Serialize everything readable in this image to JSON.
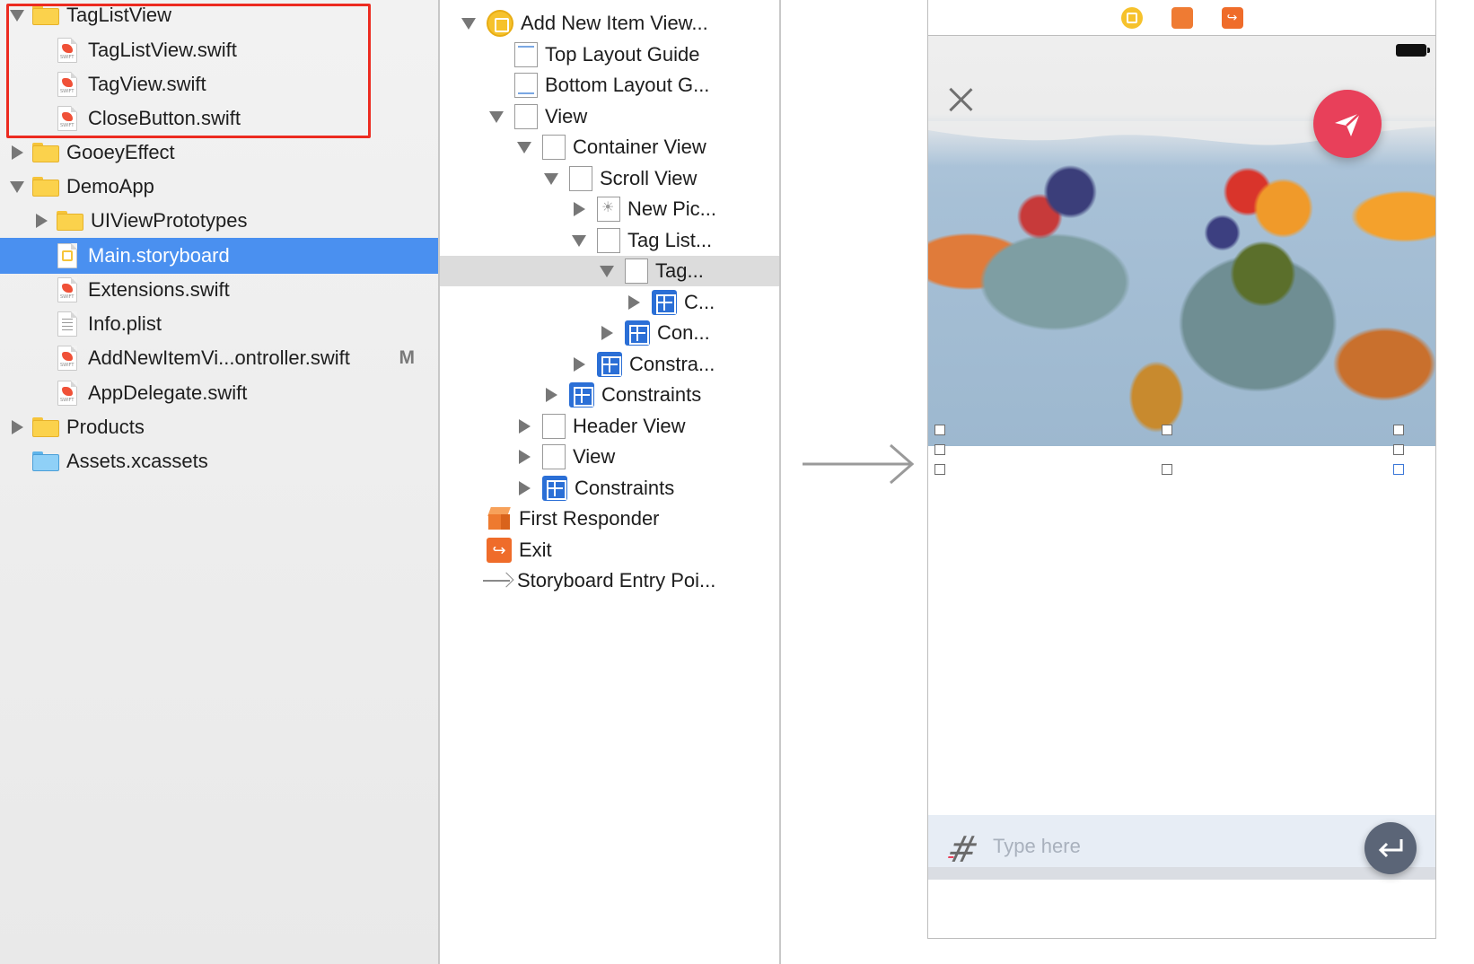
{
  "navigator": {
    "items": [
      {
        "label": "TagListView",
        "kind": "folder",
        "expanded": true
      },
      {
        "label": "TagListView.swift",
        "kind": "swift"
      },
      {
        "label": "TagView.swift",
        "kind": "swift"
      },
      {
        "label": "CloseButton.swift",
        "kind": "swift"
      },
      {
        "label": "GooeyEffect",
        "kind": "folder",
        "expanded": false
      },
      {
        "label": "DemoApp",
        "kind": "folder",
        "expanded": true
      },
      {
        "label": "UIViewPrototypes",
        "kind": "folder",
        "expanded": false
      },
      {
        "label": "Main.storyboard",
        "kind": "storyboard",
        "selected": true
      },
      {
        "label": "Extensions.swift",
        "kind": "swift"
      },
      {
        "label": "Info.plist",
        "kind": "plist"
      },
      {
        "label": "AddNewItemVi...ontroller.swift",
        "kind": "swift",
        "badge": "M"
      },
      {
        "label": "AppDelegate.swift",
        "kind": "swift"
      },
      {
        "label": "Products",
        "kind": "folder",
        "expanded": false
      },
      {
        "label": "Assets.xcassets",
        "kind": "assets"
      }
    ],
    "highlight_color": "#ec2b20",
    "selection_color": "#4a90f0"
  },
  "outline": {
    "items": [
      {
        "label": "Add New Item View..."
      },
      {
        "label": "Top Layout Guide"
      },
      {
        "label": "Bottom Layout G..."
      },
      {
        "label": "View"
      },
      {
        "label": "Container View"
      },
      {
        "label": "Scroll View"
      },
      {
        "label": "New Pic..."
      },
      {
        "label": "Tag List..."
      },
      {
        "label": "Tag...",
        "selected": true
      },
      {
        "label": "C..."
      },
      {
        "label": "Con..."
      },
      {
        "label": "Constra..."
      },
      {
        "label": "Constraints"
      },
      {
        "label": "Header View"
      },
      {
        "label": "View"
      },
      {
        "label": "Constraints"
      },
      {
        "label": "First Responder"
      },
      {
        "label": "Exit"
      },
      {
        "label": "Storyboard Entry Poi..."
      }
    ]
  },
  "canvas": {
    "dock_icons": [
      "view-controller-icon",
      "first-responder-icon",
      "exit-icon"
    ],
    "input": {
      "placeholder": "Type here",
      "value": ""
    },
    "accent_color": "#e8405a",
    "return_button_color": "#5b6577"
  }
}
